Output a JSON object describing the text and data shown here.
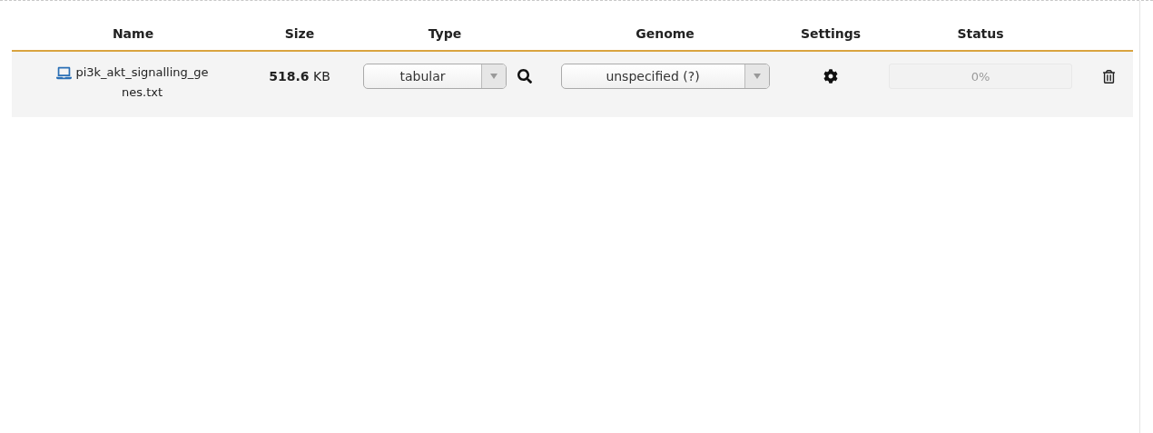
{
  "table": {
    "columns": [
      "Name",
      "Size",
      "Type",
      "Genome",
      "Settings",
      "Status"
    ],
    "rows": [
      {
        "name": "pi3k_akt_signalling_genes.txt",
        "size": "**518.6** KB",
        "type": "tabular",
        "genome": "unspecified (?)",
        "status": "0%",
        "level": 0
      }
    ]
  }
}
